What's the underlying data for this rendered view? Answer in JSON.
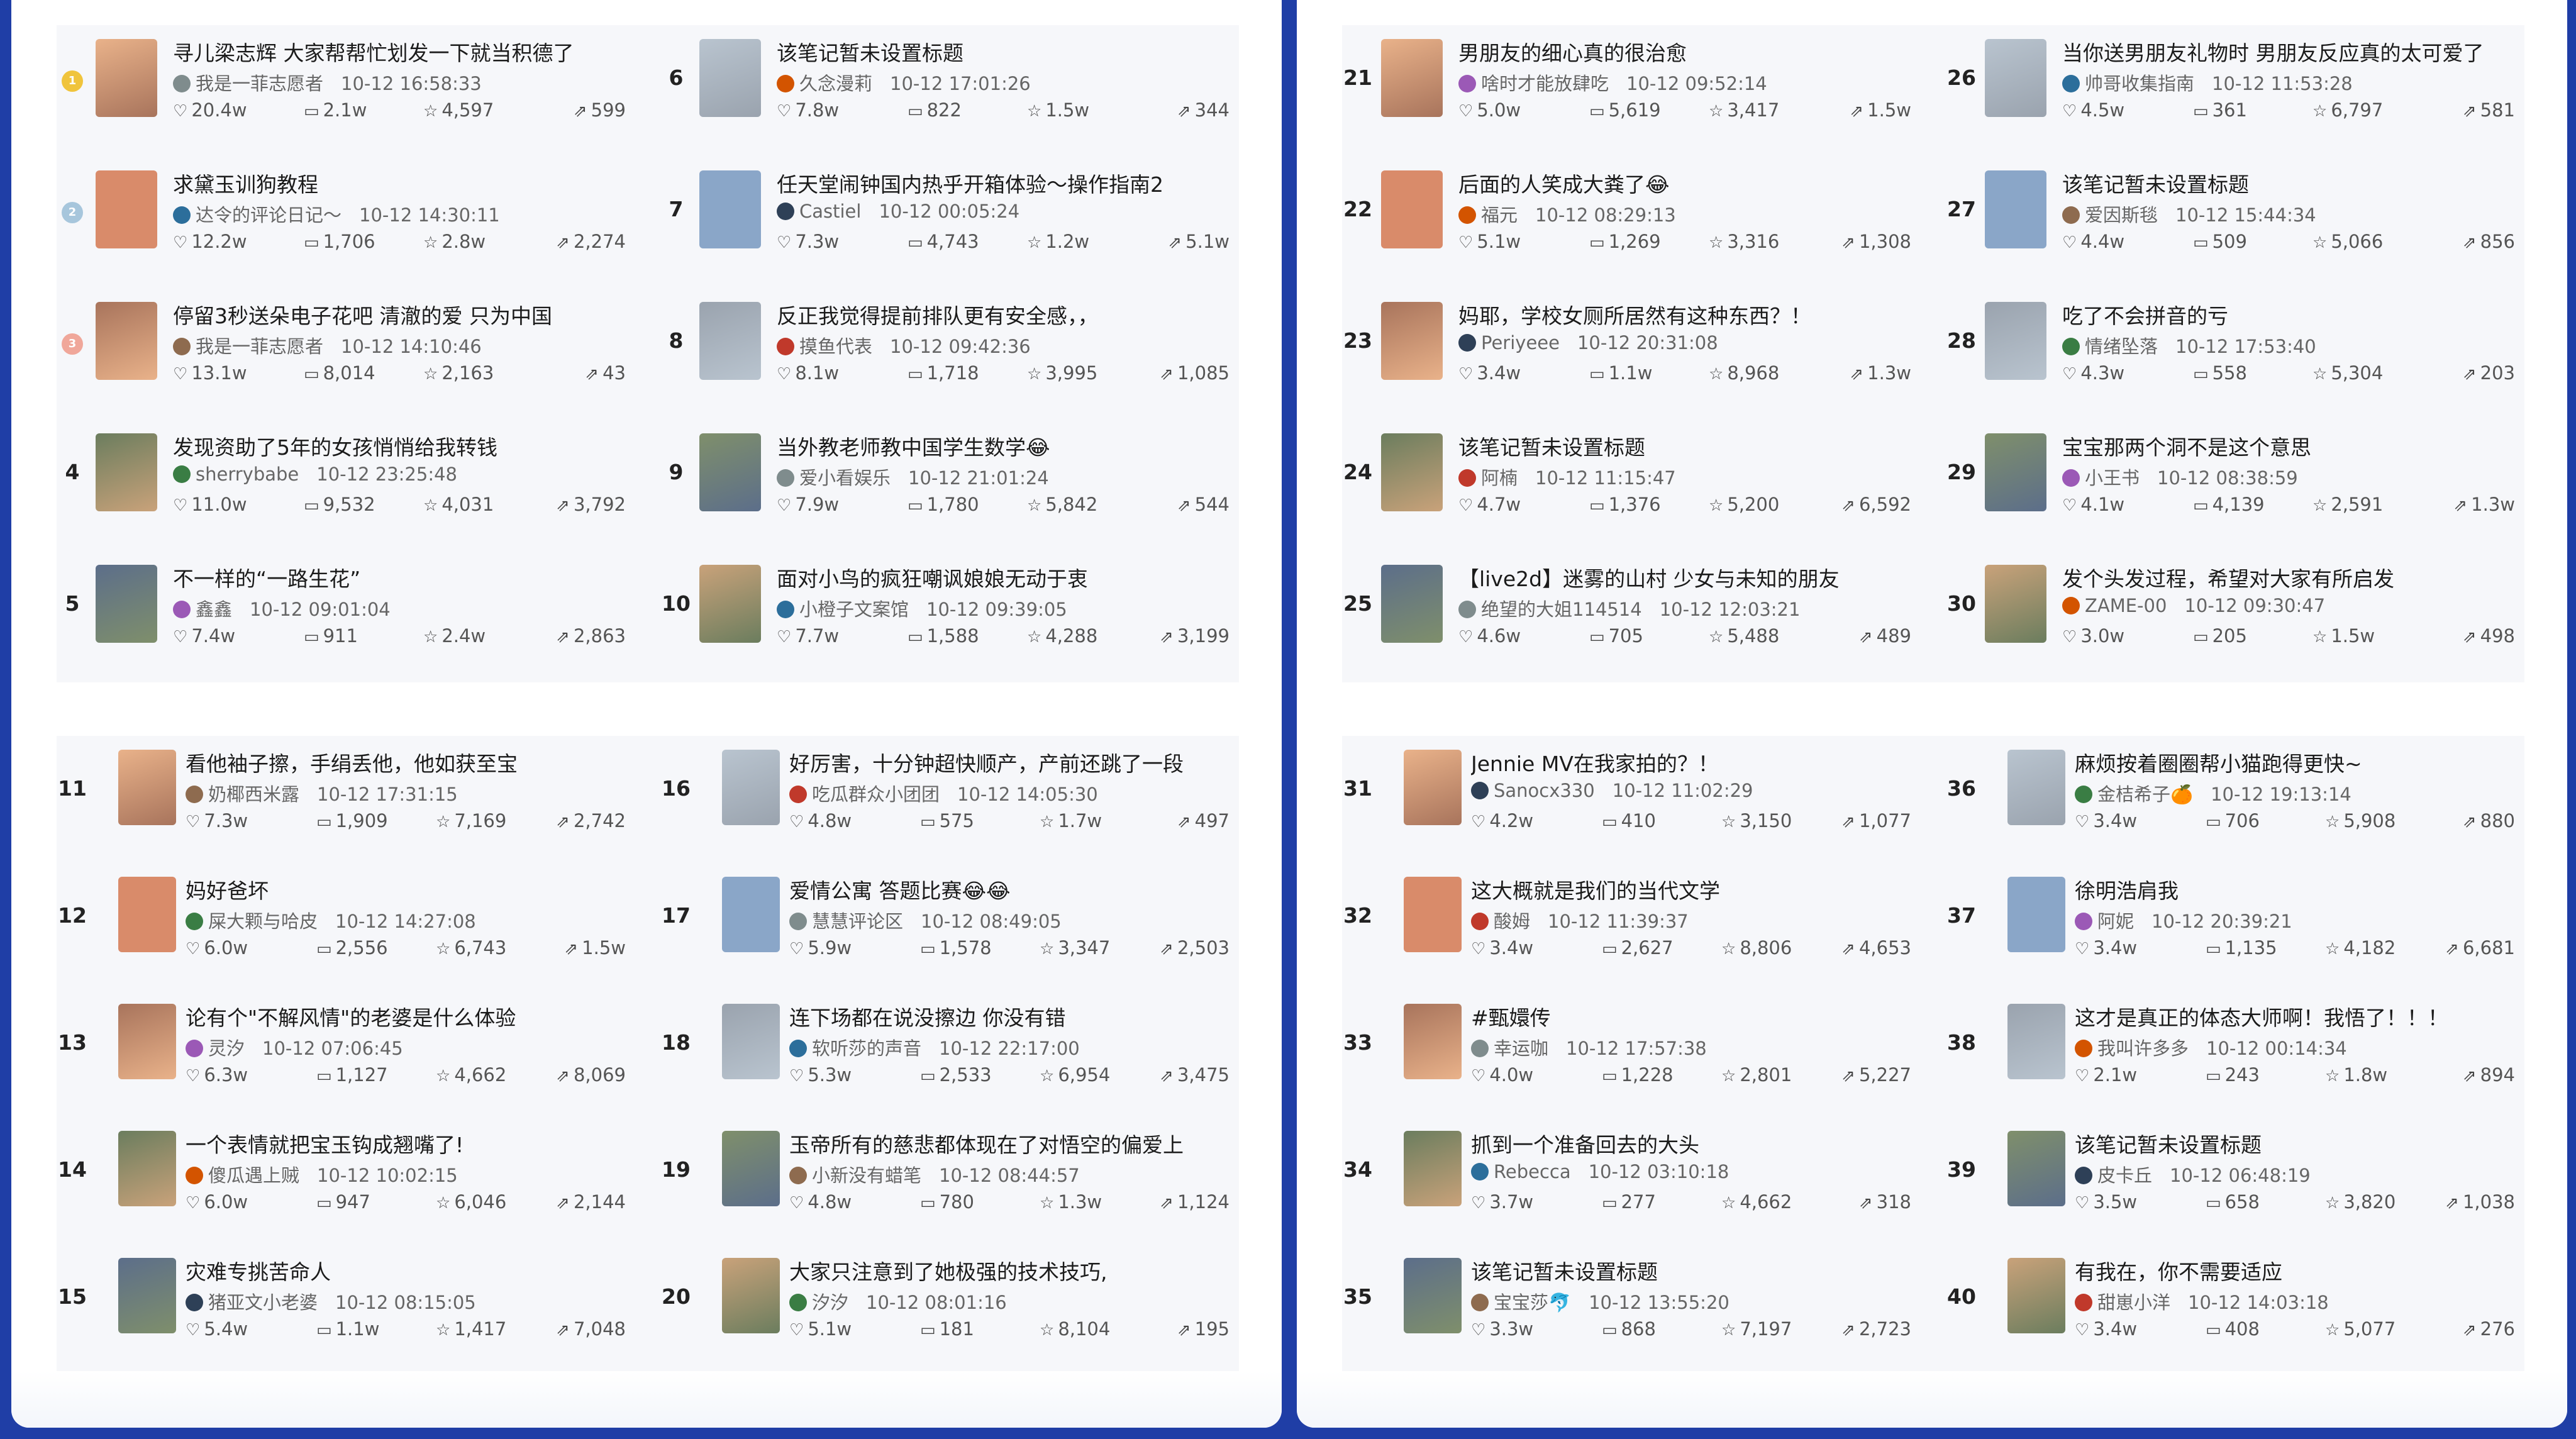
{
  "colors": {
    "frame": "#1f3ea6",
    "panel": "#ffffff",
    "block": "#f6f7fa",
    "text": "#1b1b1b",
    "meta": "#666666"
  },
  "icons": {
    "like": "heart-icon",
    "comment": "comment-icon",
    "collect": "star-icon",
    "share": "share-icon"
  },
  "left_panel": {
    "top_block": {
      "columns": [
        [
          {
            "rank": "1",
            "title": "寻儿梁志辉 大家帮帮忙划发一下就当积德了",
            "author": "我是一菲志愿者",
            "time": "10-12 16:58:33",
            "likes": "20.4w",
            "comments": "2.1w",
            "collects": "4,597",
            "shares": "599"
          },
          {
            "rank": "2",
            "title": "求黛玉训狗教程",
            "author": "达令的评论日记～",
            "time": "10-12 14:30:11",
            "likes": "12.2w",
            "comments": "1,706",
            "collects": "2.8w",
            "shares": "2,274"
          },
          {
            "rank": "3",
            "title": "停留3秒送朵电子花吧 清澈的爱 只为中国",
            "author": "我是一菲志愿者",
            "time": "10-12 14:10:46",
            "likes": "13.1w",
            "comments": "8,014",
            "collects": "2,163",
            "shares": "43"
          },
          {
            "rank": "4",
            "title": "发现资助了5年的女孩悄悄给我转钱",
            "author": "sherrybabe",
            "time": "10-12 23:25:48",
            "likes": "11.0w",
            "comments": "9,532",
            "collects": "4,031",
            "shares": "3,792"
          },
          {
            "rank": "5",
            "title": "不一样的“一路生花”",
            "author": "鑫鑫",
            "time": "10-12 09:01:04",
            "likes": "7.4w",
            "comments": "911",
            "collects": "2.4w",
            "shares": "2,863"
          }
        ],
        [
          {
            "rank": "6",
            "title": "该笔记暂未设置标题",
            "author": "久念漫莉",
            "time": "10-12 17:01:26",
            "likes": "7.8w",
            "comments": "822",
            "collects": "1.5w",
            "shares": "344"
          },
          {
            "rank": "7",
            "title": "任天堂闹钟国内热乎开箱体验～操作指南2",
            "author": "Castiel",
            "time": "10-12 00:05:24",
            "likes": "7.3w",
            "comments": "4,743",
            "collects": "1.2w",
            "shares": "5.1w"
          },
          {
            "rank": "8",
            "title": "反正我觉得提前排队更有安全感，，",
            "author": "摸鱼代表",
            "time": "10-12 09:42:36",
            "likes": "8.1w",
            "comments": "1,718",
            "collects": "3,995",
            "shares": "1,085"
          },
          {
            "rank": "9",
            "title": "当外教老师教中国学生数学😂",
            "author": "爱小看娱乐",
            "time": "10-12 21:01:24",
            "likes": "7.9w",
            "comments": "1,780",
            "collects": "5,842",
            "shares": "544"
          },
          {
            "rank": "10",
            "title": "面对小鸟的疯狂嘲讽娘娘无动于衷",
            "author": "小橙子文案馆",
            "time": "10-12 09:39:05",
            "likes": "7.7w",
            "comments": "1,588",
            "collects": "4,288",
            "shares": "3,199"
          }
        ]
      ]
    },
    "bottom_block": {
      "columns": [
        [
          {
            "rank": "11",
            "title": "看他袖子擦，手绢丢他，他如获至宝",
            "author": "奶椰西米露",
            "time": "10-12 17:31:15",
            "likes": "7.3w",
            "comments": "1,909",
            "collects": "7,169",
            "shares": "2,742"
          },
          {
            "rank": "12",
            "title": "妈好爸坏",
            "author": "屎大颗与哈皮",
            "time": "10-12 14:27:08",
            "likes": "6.0w",
            "comments": "2,556",
            "collects": "6,743",
            "shares": "1.5w"
          },
          {
            "rank": "13",
            "title": "论有个\"不解风情\"的老婆是什么体验",
            "author": "灵汐",
            "time": "10-12 07:06:45",
            "likes": "6.3w",
            "comments": "1,127",
            "collects": "4,662",
            "shares": "8,069"
          },
          {
            "rank": "14",
            "title": "一个表情就把宝玉钩成翘嘴了!",
            "author": "傻瓜遇上贼",
            "time": "10-12 10:02:15",
            "likes": "6.0w",
            "comments": "947",
            "collects": "6,046",
            "shares": "2,144"
          },
          {
            "rank": "15",
            "title": "灾难专挑苦命人",
            "author": "猪亚文小老婆",
            "time": "10-12 08:15:05",
            "likes": "5.4w",
            "comments": "1.1w",
            "collects": "1,417",
            "shares": "7,048"
          }
        ],
        [
          {
            "rank": "16",
            "title": "好厉害，十分钟超快顺产，产前还跳了一段",
            "author": "吃瓜群众小团团",
            "time": "10-12 14:05:30",
            "likes": "4.8w",
            "comments": "575",
            "collects": "1.7w",
            "shares": "497"
          },
          {
            "rank": "17",
            "title": "爱情公寓 答题比赛😂😂",
            "author": "慧慧评论区",
            "time": "10-12 08:49:05",
            "likes": "5.9w",
            "comments": "1,578",
            "collects": "3,347",
            "shares": "2,503"
          },
          {
            "rank": "18",
            "title": "连下场都在说没擦边 你没有错",
            "author": "软听莎的声音",
            "time": "10-12 22:17:00",
            "likes": "5.3w",
            "comments": "2,533",
            "collects": "6,954",
            "shares": "3,475"
          },
          {
            "rank": "19",
            "title": "玉帝所有的慈悲都体现在了对悟空的偏爱上",
            "author": "小新没有蜡笔",
            "time": "10-12 08:44:57",
            "likes": "4.8w",
            "comments": "780",
            "collects": "1.3w",
            "shares": "1,124"
          },
          {
            "rank": "20",
            "title": "大家只注意到了她极强的技术技巧,",
            "author": "汐汐",
            "time": "10-12 08:01:16",
            "likes": "5.1w",
            "comments": "181",
            "collects": "8,104",
            "shares": "195"
          }
        ]
      ]
    }
  },
  "right_panel": {
    "top_block": {
      "columns": [
        [
          {
            "rank": "21",
            "title": "男朋友的细心真的很治愈",
            "author": "啥时才能放肆吃",
            "time": "10-12 09:52:14",
            "likes": "5.0w",
            "comments": "5,619",
            "collects": "3,417",
            "shares": "1.5w"
          },
          {
            "rank": "22",
            "title": "后面的人笑成大粪了😂",
            "author": "福元",
            "time": "10-12 08:29:13",
            "likes": "5.1w",
            "comments": "1,269",
            "collects": "3,316",
            "shares": "1,308"
          },
          {
            "rank": "23",
            "title": "妈耶，学校女厕所居然有这种东西？！",
            "author": "Periyeee",
            "time": "10-12 20:31:08",
            "likes": "3.4w",
            "comments": "1.1w",
            "collects": "8,968",
            "shares": "1.3w"
          },
          {
            "rank": "24",
            "title": "该笔记暂未设置标题",
            "author": "阿楠",
            "time": "10-12 11:15:47",
            "likes": "4.7w",
            "comments": "1,376",
            "collects": "5,200",
            "shares": "6,592"
          },
          {
            "rank": "25",
            "title": "【live2d】迷雾的山村 少女与未知的朋友",
            "author": "绝望的大姐114514",
            "time": "10-12 12:03:21",
            "likes": "4.6w",
            "comments": "705",
            "collects": "5,488",
            "shares": "489"
          }
        ],
        [
          {
            "rank": "26",
            "title": "当你送男朋友礼物时 男朋友反应真的太可爱了",
            "author": "帅哥收集指南",
            "time": "10-12 11:53:28",
            "likes": "4.5w",
            "comments": "361",
            "collects": "6,797",
            "shares": "581"
          },
          {
            "rank": "27",
            "title": "该笔记暂未设置标题",
            "author": "爱因斯毯",
            "time": "10-12 15:44:34",
            "likes": "4.4w",
            "comments": "509",
            "collects": "5,066",
            "shares": "856"
          },
          {
            "rank": "28",
            "title": "吃了不会拼音的亏",
            "author": "情绪坠落",
            "time": "10-12 17:53:40",
            "likes": "4.3w",
            "comments": "558",
            "collects": "5,304",
            "shares": "203"
          },
          {
            "rank": "29",
            "title": "宝宝那两个洞不是这个意思",
            "author": "小王书",
            "time": "10-12 08:38:59",
            "likes": "4.1w",
            "comments": "4,139",
            "collects": "2,591",
            "shares": "1.3w"
          },
          {
            "rank": "30",
            "title": "发个头发过程，希望对大家有所启发",
            "author": "ZAME-00",
            "time": "10-12 09:30:47",
            "likes": "3.0w",
            "comments": "205",
            "collects": "1.5w",
            "shares": "498"
          }
        ]
      ]
    },
    "bottom_block": {
      "columns": [
        [
          {
            "rank": "31",
            "title": "Jennie MV在我家拍的？！",
            "author": "Sanocx330",
            "time": "10-12 11:02:29",
            "likes": "4.2w",
            "comments": "410",
            "collects": "3,150",
            "shares": "1,077"
          },
          {
            "rank": "32",
            "title": "这大概就是我们的当代文学",
            "author": "酸姆",
            "time": "10-12 11:39:37",
            "likes": "3.4w",
            "comments": "2,627",
            "collects": "8,806",
            "shares": "4,653"
          },
          {
            "rank": "33",
            "title": "#甄嬛传",
            "author": "幸运咖",
            "time": "10-12 17:57:38",
            "likes": "4.0w",
            "comments": "1,228",
            "collects": "2,801",
            "shares": "5,227"
          },
          {
            "rank": "34",
            "title": "抓到一个准备回去的大头",
            "author": "Rebecca",
            "time": "10-12 03:10:18",
            "likes": "3.7w",
            "comments": "277",
            "collects": "4,662",
            "shares": "318"
          },
          {
            "rank": "35",
            "title": "该笔记暂未设置标题",
            "author": "宝宝莎🐬",
            "time": "10-12 13:55:20",
            "likes": "3.3w",
            "comments": "868",
            "collects": "7,197",
            "shares": "2,723"
          }
        ],
        [
          {
            "rank": "36",
            "title": "麻烦按着圈圈帮小猫跑得更快~",
            "author": "金桔希子🍊",
            "time": "10-12 19:13:14",
            "likes": "3.4w",
            "comments": "706",
            "collects": "5,908",
            "shares": "880"
          },
          {
            "rank": "37",
            "title": "徐明浩肩我",
            "author": "阿妮",
            "time": "10-12 20:39:21",
            "likes": "3.4w",
            "comments": "1,135",
            "collects": "4,182",
            "shares": "6,681"
          },
          {
            "rank": "38",
            "title": "这才是真正的体态大师啊！我悟了！！！",
            "author": "我叫许多多",
            "time": "10-12 00:14:34",
            "likes": "2.1w",
            "comments": "243",
            "collects": "1.8w",
            "shares": "894"
          },
          {
            "rank": "39",
            "title": "该笔记暂未设置标题",
            "author": "皮卡丘",
            "time": "10-12 06:48:19",
            "likes": "3.5w",
            "comments": "658",
            "collects": "3,820",
            "shares": "1,038"
          },
          {
            "rank": "40",
            "title": "有我在，你不需要适应",
            "author": "甜崽小洋",
            "time": "10-12 14:03:18",
            "likes": "3.4w",
            "comments": "408",
            "collects": "5,077",
            "shares": "276"
          }
        ]
      ]
    }
  }
}
